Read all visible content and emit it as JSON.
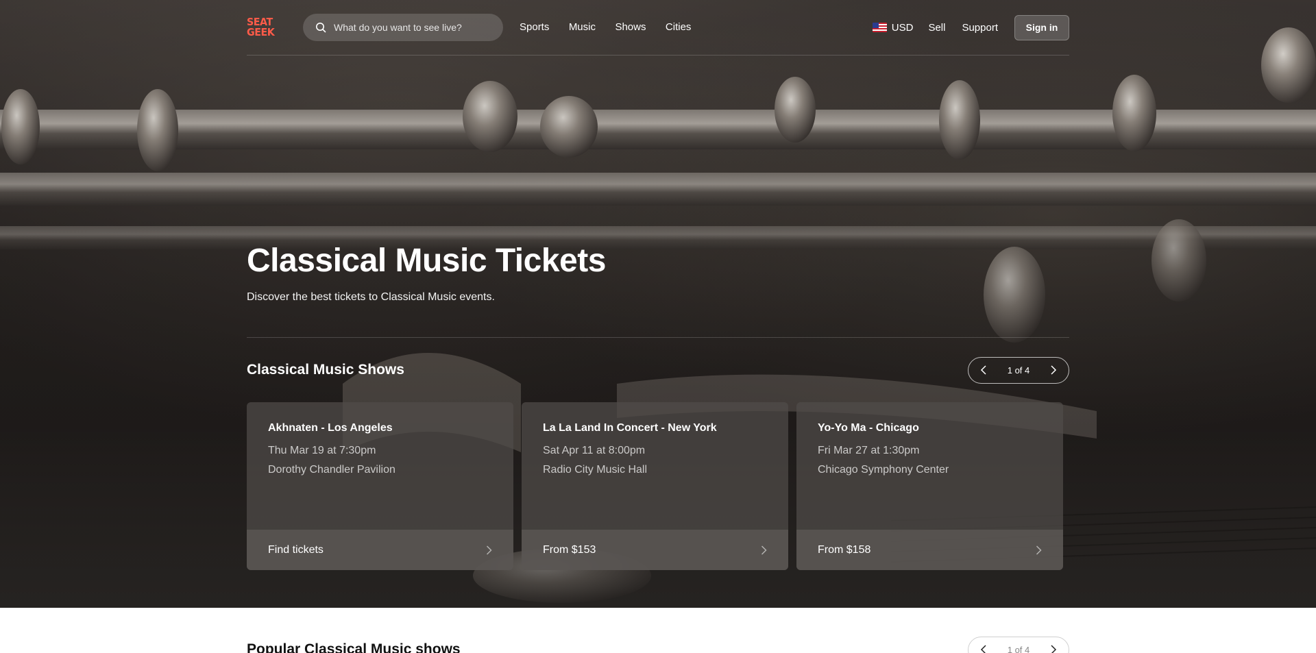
{
  "header": {
    "logo_line1": "SEAT",
    "logo_line2": "GEEK",
    "search_placeholder": "What do you want to see live?",
    "nav": [
      "Sports",
      "Music",
      "Shows",
      "Cities"
    ],
    "currency": "USD",
    "sell": "Sell",
    "support": "Support",
    "signin": "Sign in"
  },
  "hero": {
    "title": "Classical Music Tickets",
    "subtitle": "Discover the best tickets to Classical Music events."
  },
  "shows": {
    "title": "Classical Music Shows",
    "pager": "1 of 4",
    "cards": [
      {
        "title": "Akhnaten - Los Angeles",
        "date": "Thu Mar 19 at 7:30pm",
        "venue": "Dorothy Chandler Pavilion",
        "cta": "Find tickets"
      },
      {
        "title": "La La Land In Concert - New York",
        "date": "Sat Apr 11 at 8:00pm",
        "venue": "Radio City Music Hall",
        "cta": "From $153"
      },
      {
        "title": "Yo-Yo Ma - Chicago",
        "date": "Fri Mar 27 at 1:30pm",
        "venue": "Chicago Symphony Center",
        "cta": "From $158"
      }
    ]
  },
  "popular": {
    "title": "Popular Classical Music shows",
    "pager": "1 of 4"
  },
  "colors": {
    "brand": "#ff5b49"
  }
}
